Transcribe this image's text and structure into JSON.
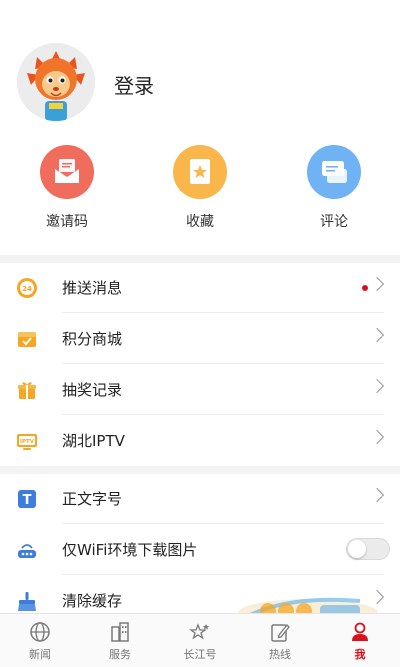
{
  "profile": {
    "login_label": "登录"
  },
  "quick_actions": [
    {
      "label": "邀请码",
      "icon": "invite-envelope-icon",
      "color": "#f06d5e"
    },
    {
      "label": "收藏",
      "icon": "favorite-bookmark-icon",
      "color": "#f9b64b"
    },
    {
      "label": "评论",
      "icon": "comment-chat-icon",
      "color": "#6fb3f5"
    }
  ],
  "menu_group_1": [
    {
      "label": "推送消息",
      "icon": "push-24-icon",
      "unread": true
    },
    {
      "label": "积分商城",
      "icon": "points-mall-icon"
    },
    {
      "label": "抽奖记录",
      "icon": "gift-icon"
    },
    {
      "label": "湖北IPTV",
      "icon": "iptv-tv-icon",
      "icon_text": "IPTV"
    }
  ],
  "menu_group_2": [
    {
      "label": "正文字号",
      "icon": "font-size-icon",
      "icon_text": "T"
    },
    {
      "label": "仅WiFi环境下载图片",
      "icon": "router-icon",
      "toggle": false
    },
    {
      "label": "清除缓存",
      "icon": "broom-icon"
    }
  ],
  "tabs": [
    {
      "label": "新闻",
      "icon": "globe-icon",
      "active": false
    },
    {
      "label": "服务",
      "icon": "buildings-icon",
      "active": false
    },
    {
      "label": "长江号",
      "icon": "stars-icon",
      "active": false
    },
    {
      "label": "热线",
      "icon": "edit-pen-icon",
      "active": false
    },
    {
      "label": "我",
      "icon": "user-me-icon",
      "active": true
    }
  ],
  "colors": {
    "accent_red": "#d8121d",
    "icon_orange": "#f5a623",
    "icon_blue": "#3d7ddb"
  }
}
